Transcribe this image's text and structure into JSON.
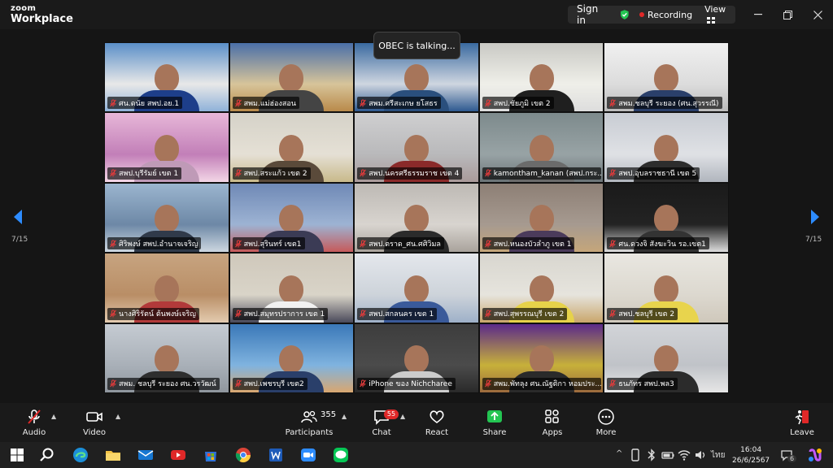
{
  "app": {
    "brand_small": "zoom",
    "brand_large": "Workplace"
  },
  "top_controls": {
    "sign_in": "Sign in",
    "recording": "Recording",
    "view": "View",
    "accent": "#2d8cff"
  },
  "speaker_toast": "OBEC is talking...",
  "pagination": {
    "left": "7/15",
    "right": "7/15"
  },
  "participants": [
    "ศน.ดนัย สพป.อย.1",
    "สพม.แม่ฮ่องสอน",
    "สพม.ศรีสะเกษ ยโสธร",
    "สพป.ชัยภูมิ เขต 2",
    "สพม.ชลบุรี ระยอง (ศน.สุวรรณี)",
    "สพป.บุรีรัมย์ เขต 1",
    "สพป.สระแก้ว เขต 2",
    "สพป.นครศรีธรรมราช เขต 4",
    "kamontham_kanan (สพป.กระ...",
    "สพป.อุบลราชธานี เขต 5",
    "ศิริพงษ์ สพป.อำนาจเจริญ",
    "สพป.สุรินทร์ เขต1",
    "สพป.ตราด_ศน.ศศิวิมล",
    "สพป.หนองบัวลำภู เขต 1",
    "ศน.ดวงจิ สังฆะวิน รอ.เขต1",
    "นางศิริรัตน์ ต้นพงษ์เจริญ",
    "สพป.สมุทรปราการ เขต 1",
    "สพป.สกลนคร เขต 1",
    "สพป.สุพรรณบุรี เขต 2",
    "สพป.ชลบุรี เขต 2",
    "สพม. ชลบุรี ระยอง ศน.วรวัฒน์",
    "สพป.เพชรบุรี เขต2",
    "iPhone ของ Nichcharee",
    "สพม.พัทลุง ศน.ณัฐติกา หอมประ...",
    "ธนภัทร สพป.พล3"
  ],
  "toolbar": {
    "audio": "Audio",
    "video": "Video",
    "participants": "Participants",
    "participants_count": "355",
    "chat": "Chat",
    "chat_badge": "55",
    "react": "React",
    "share": "Share",
    "apps": "Apps",
    "more": "More",
    "leave": "Leave"
  },
  "taskbar": {
    "time": "16:04",
    "date": "26/6/2567",
    "lang": "ไทย",
    "notifications": "6"
  }
}
